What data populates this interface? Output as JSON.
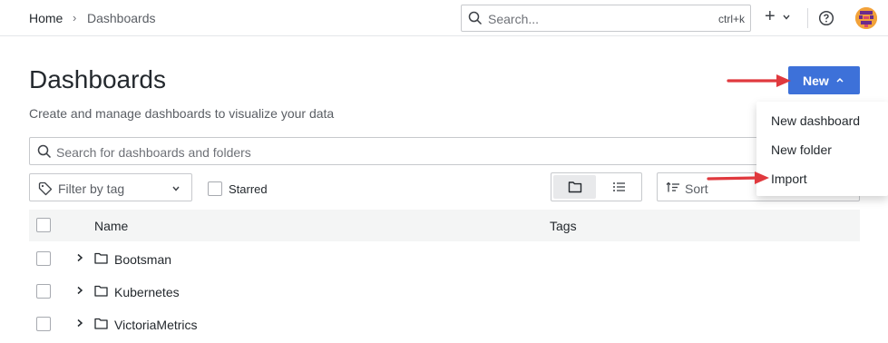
{
  "breadcrumb": {
    "home": "Home",
    "separator": "›",
    "current": "Dashboards"
  },
  "topbar": {
    "search_placeholder": "Search...",
    "search_shortcut": "ctrl+k",
    "plus_label": "+",
    "icons": [
      "search-icon",
      "plus-icon",
      "chevron-down-icon",
      "help-icon",
      "avatar"
    ]
  },
  "page": {
    "title": "Dashboards",
    "subtitle": "Create and manage dashboards to visualize your data",
    "new_button_label": "New"
  },
  "new_menu": {
    "items": [
      "New dashboard",
      "New folder",
      "Import"
    ]
  },
  "filters": {
    "search_placeholder": "Search for dashboards and folders",
    "tag_filter_placeholder": "Filter by tag",
    "starred_label": "Starred",
    "sort_placeholder": "Sort",
    "view_mode": "folder"
  },
  "table": {
    "columns": [
      "Name",
      "Tags"
    ],
    "rows": [
      {
        "name": "Bootsman",
        "tags": ""
      },
      {
        "name": "Kubernetes",
        "tags": ""
      },
      {
        "name": "VictoriaMetrics",
        "tags": ""
      }
    ]
  },
  "colors": {
    "primary_button": "#3d71d9",
    "annotation_arrow": "#e0393e",
    "table_header_bg": "#f4f5f5"
  }
}
